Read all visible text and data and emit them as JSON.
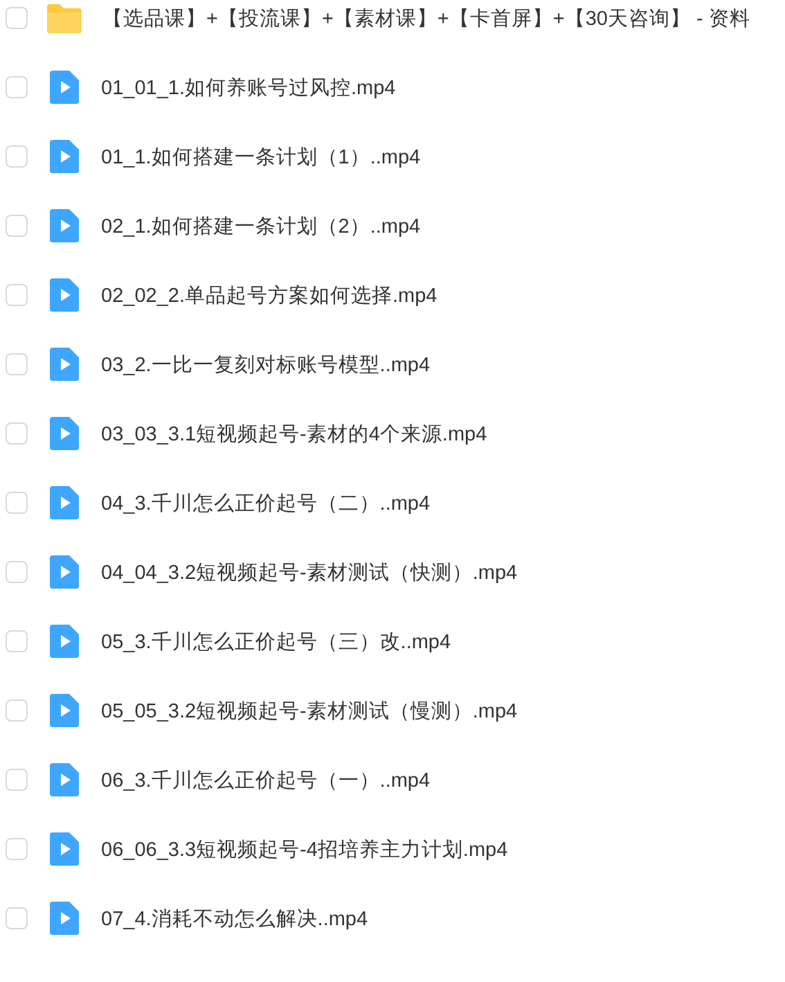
{
  "files": [
    {
      "kind": "folder",
      "name": "【选品课】+【投流课】+【素材课】+【卡首屏】+【30天咨询】 - 资料",
      "checked": false
    },
    {
      "kind": "video",
      "name": "01_01_1.如何养账号过风控.mp4",
      "checked": false
    },
    {
      "kind": "video",
      "name": "01_1.如何搭建一条计划（1）..mp4",
      "checked": false
    },
    {
      "kind": "video",
      "name": "02_1.如何搭建一条计划（2）..mp4",
      "checked": false
    },
    {
      "kind": "video",
      "name": "02_02_2.单品起号方案如何选择.mp4",
      "checked": false
    },
    {
      "kind": "video",
      "name": "03_2.一比一复刻对标账号模型..mp4",
      "checked": false
    },
    {
      "kind": "video",
      "name": "03_03_3.1短视频起号-素材的4个来源.mp4",
      "checked": false
    },
    {
      "kind": "video",
      "name": "04_3.千川怎么正价起号（二）..mp4",
      "checked": false
    },
    {
      "kind": "video",
      "name": "04_04_3.2短视频起号-素材测试（快测）.mp4",
      "checked": false
    },
    {
      "kind": "video",
      "name": "05_3.千川怎么正价起号（三）改..mp4",
      "checked": false
    },
    {
      "kind": "video",
      "name": "05_05_3.2短视频起号-素材测试（慢测）.mp4",
      "checked": false
    },
    {
      "kind": "video",
      "name": "06_3.千川怎么正价起号（一）..mp4",
      "checked": false
    },
    {
      "kind": "video",
      "name": "06_06_3.3短视频起号-4招培养主力计划.mp4",
      "checked": false
    },
    {
      "kind": "video",
      "name": "07_4.消耗不动怎么解决..mp4",
      "checked": false
    }
  ]
}
